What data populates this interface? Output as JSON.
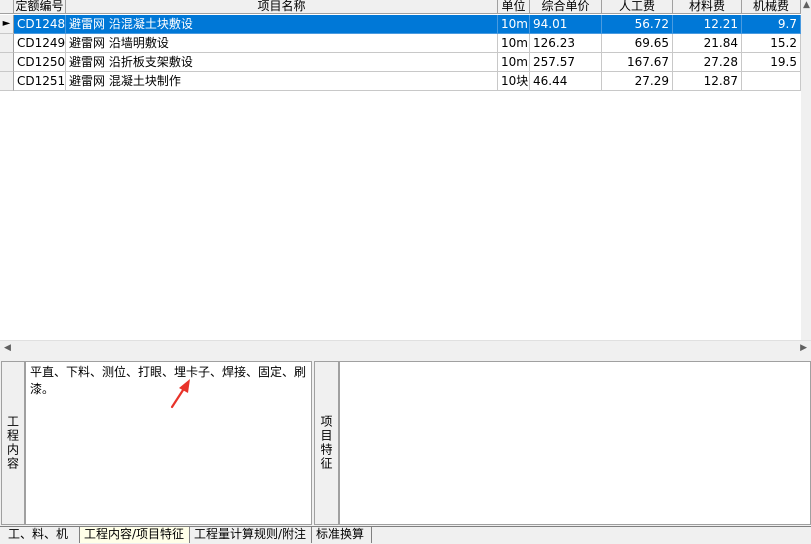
{
  "grid": {
    "columns": [
      "定额编号",
      "项目名称",
      "单位",
      "综合单价",
      "人工费",
      "材料费",
      "机械费"
    ],
    "rows": [
      {
        "code": "CD1248",
        "name": "避雷网 沿混凝土块敷设",
        "unit": "10m",
        "price": "94.01",
        "labor": "56.72",
        "material": "12.21",
        "machine": "9.7",
        "selected": true
      },
      {
        "code": "CD1249",
        "name": "避雷网 沿墙明敷设",
        "unit": "10m",
        "price": "126.23",
        "labor": "69.65",
        "material": "21.84",
        "machine": "15.2",
        "selected": false
      },
      {
        "code": "CD1250",
        "name": "避雷网 沿折板支架敷设",
        "unit": "10m",
        "price": "257.57",
        "labor": "167.67",
        "material": "27.28",
        "machine": "19.5",
        "selected": false
      },
      {
        "code": "CD1251",
        "name": "避雷网 混凝土块制作",
        "unit": "10块",
        "price": "46.44",
        "labor": "27.29",
        "material": "12.87",
        "machine": "",
        "selected": false
      }
    ]
  },
  "panels": {
    "work_content_label": "工程内容",
    "work_content_text": "平直、下料、测位、打眼、埋卡子、焊接、固定、刷漆。",
    "item_feature_label": "项目特征",
    "item_feature_text": ""
  },
  "tabs": [
    {
      "label": "工、料、机",
      "active": false
    },
    {
      "label": "工程内容/项目特征",
      "active": true
    },
    {
      "label": "工程量计算规则/附注",
      "active": false
    },
    {
      "label": "标准换算",
      "active": false
    }
  ],
  "colors": {
    "selection": "#0078d7",
    "annotation_arrow": "#e8332a"
  }
}
